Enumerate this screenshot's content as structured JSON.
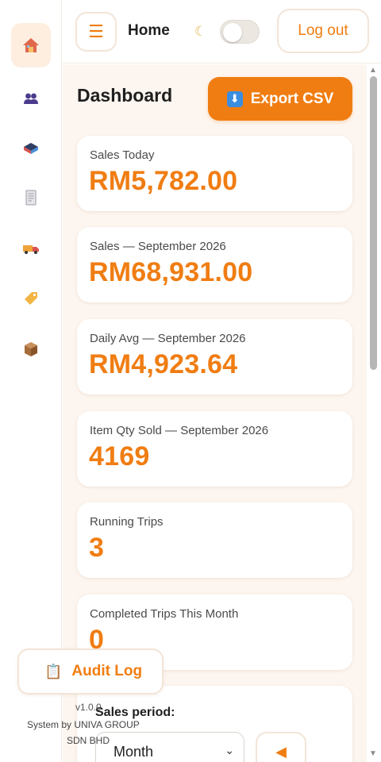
{
  "header": {
    "menu_icon": "hamburger-icon",
    "title": "Home",
    "theme_icon": "moon-icon",
    "theme_toggle_on": false,
    "logout_label": "Log out"
  },
  "sidebar": {
    "items": [
      {
        "name": "home",
        "icon": "house-icon",
        "active": true
      },
      {
        "name": "customers",
        "icon": "users-icon",
        "active": false
      },
      {
        "name": "inventory",
        "icon": "boxes-icon",
        "active": false
      },
      {
        "name": "reports",
        "icon": "document-icon",
        "active": false
      },
      {
        "name": "deliveries",
        "icon": "truck-icon",
        "active": false
      },
      {
        "name": "pricing",
        "icon": "tag-icon",
        "active": false
      },
      {
        "name": "products",
        "icon": "package-icon",
        "active": false
      }
    ]
  },
  "main": {
    "title": "Dashboard",
    "export_label": "Export CSV",
    "export_icon": "download-icon",
    "cards": [
      {
        "label": "Sales Today",
        "value": "RM5,782.00"
      },
      {
        "label": "Sales — September 2026",
        "value": "RM68,931.00"
      },
      {
        "label": "Daily Avg — September 2026",
        "value": "RM4,923.64"
      },
      {
        "label": "Item Qty Sold — September 2026",
        "value": "4169"
      },
      {
        "label": "Running Trips",
        "value": "3"
      },
      {
        "label": "Completed Trips This Month",
        "value": "0"
      }
    ],
    "period": {
      "label": "Sales period:",
      "selected": "Month",
      "prev_icon": "triangle-left-icon"
    }
  },
  "floating": {
    "audit_label": "Audit Log",
    "audit_icon": "clipboard-icon"
  },
  "footer": {
    "version": "v1.0.0",
    "line1": "System by UNIVA GROUP",
    "line2": "SDN BHD"
  },
  "colors": {
    "accent": "#f07d12",
    "background": "#fdf6f0",
    "active_nav": "#fdeee0"
  }
}
